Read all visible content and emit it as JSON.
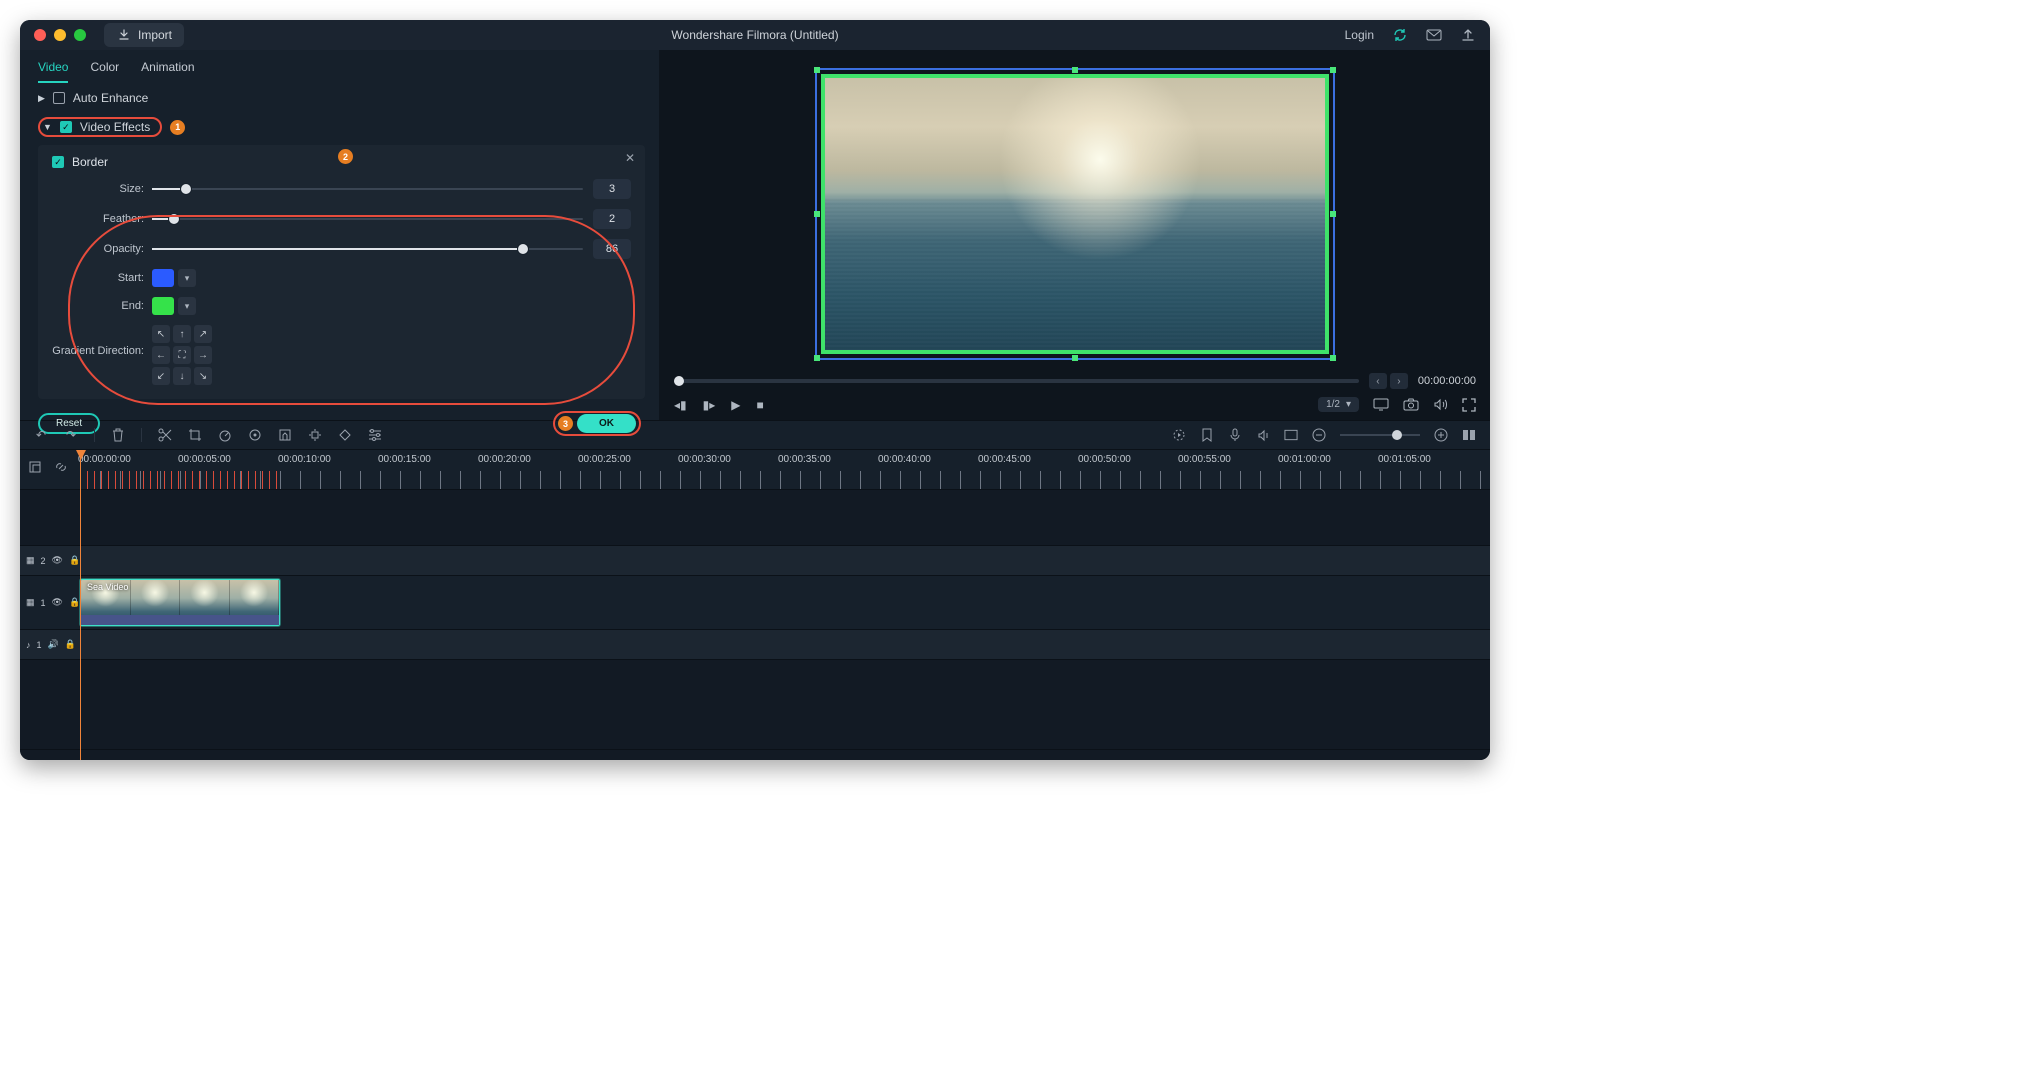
{
  "titlebar": {
    "import_label": "Import",
    "app_title": "Wondershare Filmora (Untitled)",
    "login_label": "Login"
  },
  "tabs": {
    "video": "Video",
    "color": "Color",
    "animation": "Animation"
  },
  "sections": {
    "auto_enhance": "Auto Enhance",
    "video_effects": "Video Effects",
    "border": "Border"
  },
  "badges": {
    "b1": "1",
    "b2": "2",
    "b3": "3"
  },
  "props": {
    "size": {
      "label": "Size:",
      "value": "3",
      "pct": 8
    },
    "feather": {
      "label": "Feather:",
      "value": "2",
      "pct": 5
    },
    "opacity": {
      "label": "Opacity:",
      "value": "86",
      "pct": 86
    },
    "start": {
      "label": "Start:",
      "color": "#2b5bff"
    },
    "end": {
      "label": "End:",
      "color": "#35e24a"
    },
    "grad": {
      "label": "Gradient Direction:"
    }
  },
  "buttons": {
    "reset": "Reset",
    "ok": "OK"
  },
  "preview": {
    "timecode": "00:00:00:00",
    "zoom": "1/2"
  },
  "ruler": {
    "labels": [
      "00:00:00:00",
      "00:00:05:00",
      "00:00:10:00",
      "00:00:15:00",
      "00:00:20:00",
      "00:00:25:00",
      "00:00:30:00",
      "00:00:35:00",
      "00:00:40:00",
      "00:00:45:00",
      "00:00:50:00",
      "00:00:55:00",
      "00:01:00:00",
      "00:01:05:00"
    ]
  },
  "tracks": {
    "t2_badge": "2",
    "t1_badge": "1",
    "audio_badge": "1",
    "clip_name": "Sea Video"
  }
}
